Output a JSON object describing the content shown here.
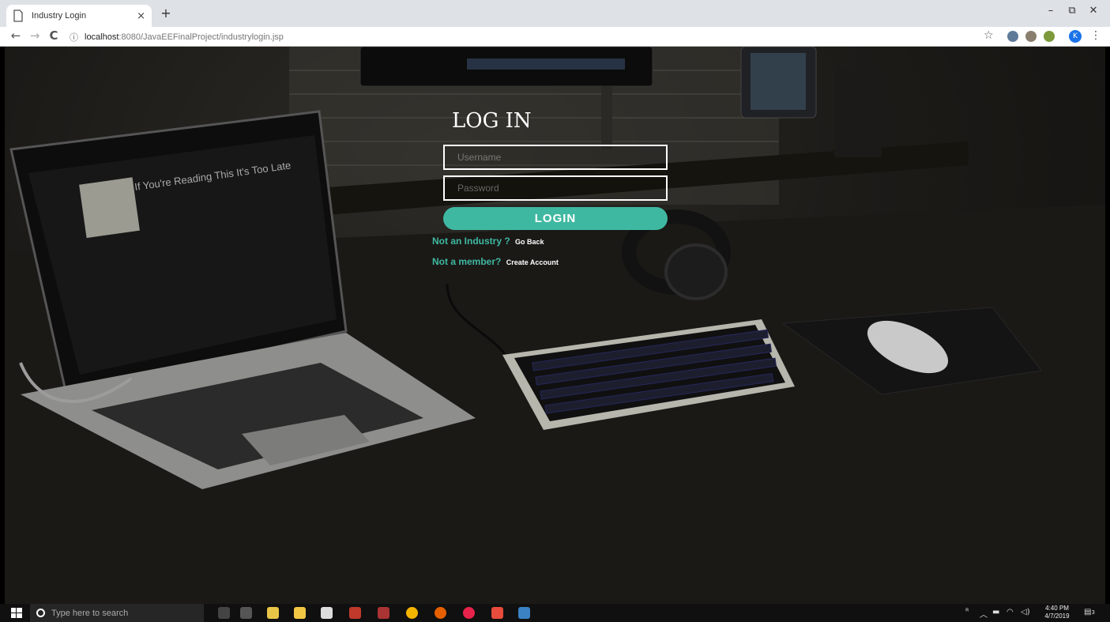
{
  "browser": {
    "tab_title": "Industry Login",
    "tab_close": "×",
    "new_tab": "+",
    "url_host": "localhost",
    "url_rest": ":8080/JavaEEFinalProject/industrylogin.jsp",
    "profile_initial": "K",
    "win_minimize": "–",
    "win_restore": "⧉",
    "win_close": "✕",
    "back": "←",
    "forward": "→",
    "reload": "C",
    "info_icon": "ⓘ",
    "star": "☆",
    "menu": "⋮"
  },
  "login": {
    "title": "LOG IN",
    "username_placeholder": "Username",
    "password_placeholder": "Password",
    "button_label": "LOGIN",
    "not_industry_text": "Not an Industry ?",
    "go_back_link": "Go Back",
    "not_member_text": "Not a member?",
    "create_account_link": "Create Account",
    "accent_color": "#3fb8a1"
  },
  "taskbar": {
    "search_placeholder": "Type here to search",
    "time": "4:40 PM",
    "date": "4/7/2019",
    "notification_count": "3"
  }
}
